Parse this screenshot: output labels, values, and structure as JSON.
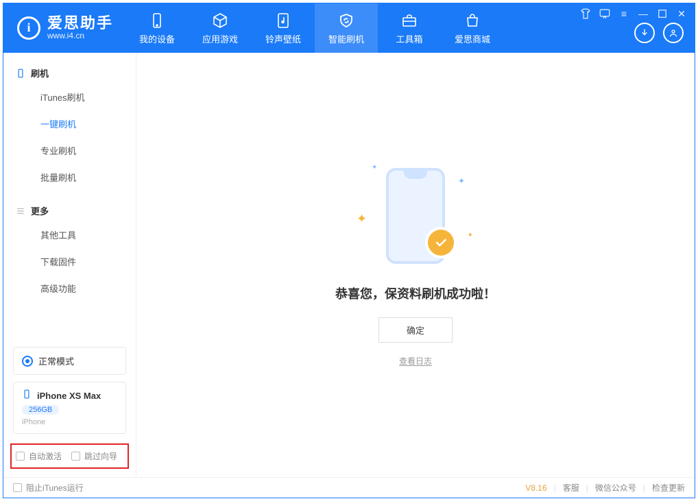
{
  "app": {
    "name_cn": "爱思助手",
    "name_en": "www.i4.cn"
  },
  "nav": [
    {
      "label": "我的设备"
    },
    {
      "label": "应用游戏"
    },
    {
      "label": "铃声壁纸"
    },
    {
      "label": "智能刷机"
    },
    {
      "label": "工具箱"
    },
    {
      "label": "爱思商城"
    }
  ],
  "sidebar": {
    "section1": {
      "title": "刷机",
      "items": [
        "iTunes刷机",
        "一键刷机",
        "专业刷机",
        "批量刷机"
      ],
      "selected_index": 1
    },
    "section2": {
      "title": "更多",
      "items": [
        "其他工具",
        "下载固件",
        "高级功能"
      ]
    }
  },
  "status": {
    "mode": "正常模式"
  },
  "device": {
    "name": "iPhone XS Max",
    "storage": "256GB",
    "type": "iPhone"
  },
  "options": {
    "auto_activate": "自动激活",
    "skip_guide": "跳过向导"
  },
  "footer": {
    "block_itunes": "阻止iTunes运行",
    "version": "V8.16",
    "link_service": "客服",
    "link_wechat": "微信公众号",
    "link_update": "检查更新"
  },
  "result": {
    "message": "恭喜您，保资料刷机成功啦！",
    "ok": "确定",
    "view_log": "查看日志"
  }
}
